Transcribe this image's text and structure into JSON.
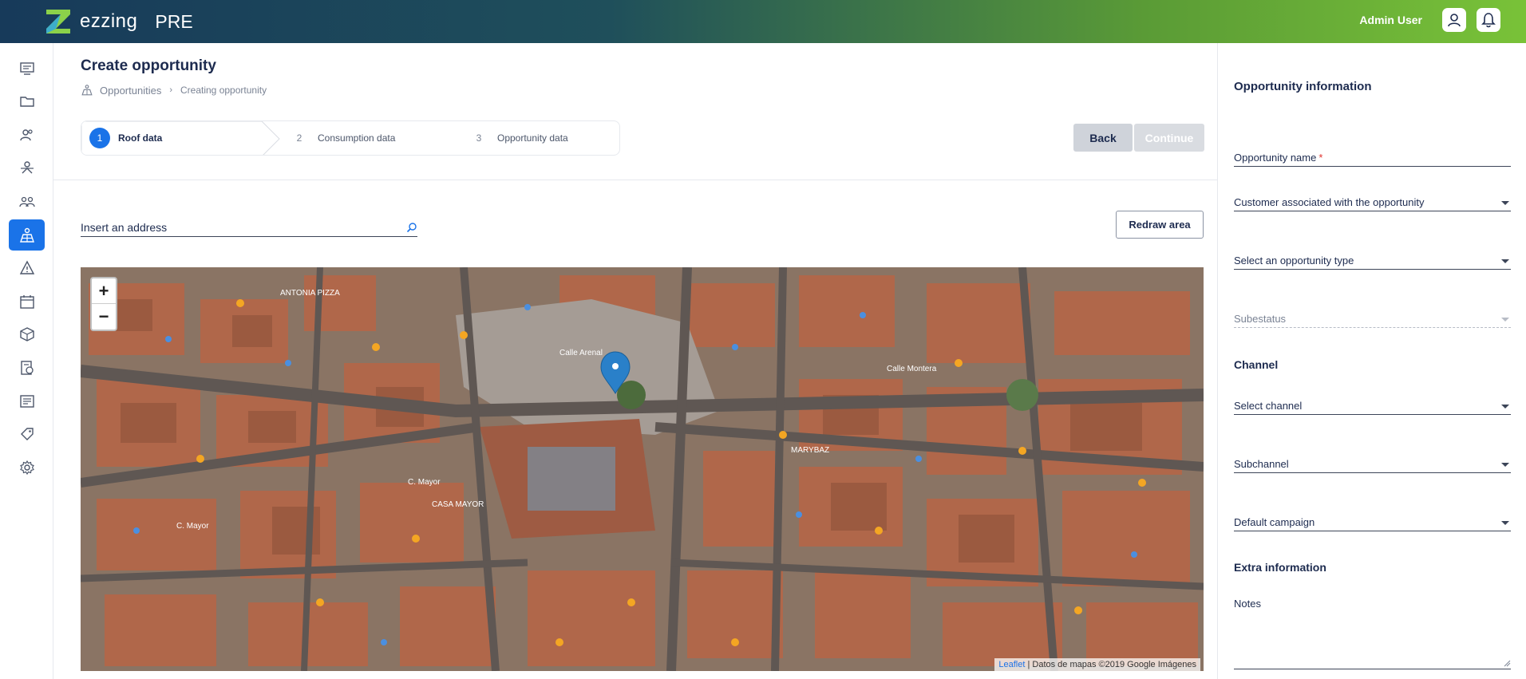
{
  "header": {
    "brand": "ezzing",
    "environment": "PRE",
    "user_name": "Admin User",
    "colors": {
      "gradient_start": "#173a5a",
      "gradient_end": "#79c238",
      "accent": "#1a73e8"
    }
  },
  "sidebar": {
    "items": [
      {
        "icon": "dashboard-icon",
        "active": false
      },
      {
        "icon": "folder-icon",
        "active": false
      },
      {
        "icon": "users-icon",
        "active": false
      },
      {
        "icon": "team-icon",
        "active": false
      },
      {
        "icon": "group-icon",
        "active": false
      },
      {
        "icon": "solar-panel-icon",
        "active": true
      },
      {
        "icon": "warning-icon",
        "active": false
      },
      {
        "icon": "calendar-icon",
        "active": false
      },
      {
        "icon": "box-icon",
        "active": false
      },
      {
        "icon": "money-icon",
        "active": false
      },
      {
        "icon": "document-icon",
        "active": false
      },
      {
        "icon": "tag-icon",
        "active": false
      },
      {
        "icon": "settings-icon",
        "active": false
      }
    ]
  },
  "page": {
    "title": "Create opportunity",
    "breadcrumb": {
      "parent": "Opportunities",
      "current": "Creating opportunity"
    }
  },
  "steps": [
    {
      "number": "1",
      "label": "Roof data",
      "active": true
    },
    {
      "number": "2",
      "label": "Consumption data",
      "active": false
    },
    {
      "number": "3",
      "label": "Opportunity data",
      "active": false
    }
  ],
  "actions": {
    "back": "Back",
    "continue": "Continue",
    "redraw": "Redraw area"
  },
  "address": {
    "placeholder": "Insert an address"
  },
  "map": {
    "zoom_in": "+",
    "zoom_out": "−",
    "attribution_link": "Leaflet",
    "attribution_text": " | Datos de mapas ©2019 Google Imágenes",
    "labels": [
      "C. Mayor",
      "C. Mayor",
      "ANTONIA PIZZA",
      "MARYBAZ",
      "CASA MAYOR",
      "Calle Arenal",
      "Calle Montera"
    ]
  },
  "panel": {
    "title": "Opportunity information",
    "fields": {
      "opportunity_name": "Opportunity name",
      "opportunity_name_required": "*",
      "customer": "Customer associated with the opportunity",
      "opportunity_type": "Select an opportunity type",
      "substatus": "Subestatus"
    },
    "channel_section": "Channel",
    "channel_fields": {
      "channel": "Select channel",
      "subchannel": "Subchannel",
      "campaign": "Default campaign"
    },
    "extra_section": "Extra information",
    "notes_label": "Notes"
  }
}
